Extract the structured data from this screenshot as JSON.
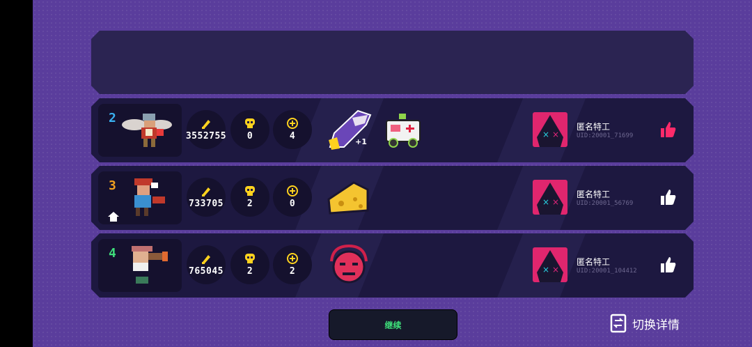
{
  "rows": [
    {
      "rank": "2",
      "rank_color": "#3ab0f0",
      "bullets": "3552755",
      "kills": "0",
      "coins": "4",
      "player_name": "匿名特工",
      "uid": "UID:20001_71699",
      "liked": true,
      "items": [
        "shark-weapon-icon",
        "ambulance-icon"
      ]
    },
    {
      "rank": "3",
      "rank_color": "#f0a020",
      "bullets": "733705",
      "kills": "2",
      "coins": "0",
      "player_name": "匿名特工",
      "uid": "UID:20001_56769",
      "liked": false,
      "items": [
        "cheese-icon"
      ]
    },
    {
      "rank": "4",
      "rank_color": "#3edc7a",
      "bullets": "765045",
      "kills": "2",
      "coins": "2",
      "player_name": "匿名特工",
      "uid": "UID:20001_104412",
      "liked": false,
      "items": [
        "demon-face-icon"
      ]
    }
  ],
  "continue_label": "继续",
  "switch_label": "切换详情",
  "colors": {
    "background": "#5a3d9c",
    "panel": "#1d1840",
    "accent_green": "#3ee07a",
    "like_active": "#ff2a6a",
    "stat_yellow": "#ffd21e"
  }
}
